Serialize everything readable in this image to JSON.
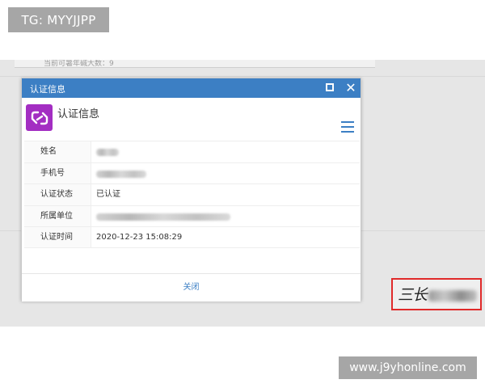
{
  "watermark_top": {
    "text": "TG: MYYJJPP"
  },
  "background": {
    "panel_text": "当前可暑年碱大数：9"
  },
  "dialog": {
    "title": "认证信息",
    "header_title": "认证信息",
    "app_icon": "purple-link-icon",
    "rows": [
      {
        "label": "姓名",
        "value": "",
        "redacted": true
      },
      {
        "label": "手机号",
        "value": "",
        "redacted": true
      },
      {
        "label": "认证状态",
        "value": "已认证",
        "redacted": false
      },
      {
        "label": "所属单位",
        "value": "",
        "redacted": true
      },
      {
        "label": "认证时间",
        "value": "2020-12-23 15:08:29",
        "redacted": false
      }
    ],
    "close_button": "关闭"
  },
  "signature": {
    "script": "三长"
  },
  "watermark_bottom": {
    "text": "www.j9yhonline.com"
  },
  "colors": {
    "titlebar": "#3c7fc4",
    "app_icon_bg": "#a32ec2",
    "highlight_border": "#e02a2a",
    "watermark_bg": "#a6a6a6"
  }
}
